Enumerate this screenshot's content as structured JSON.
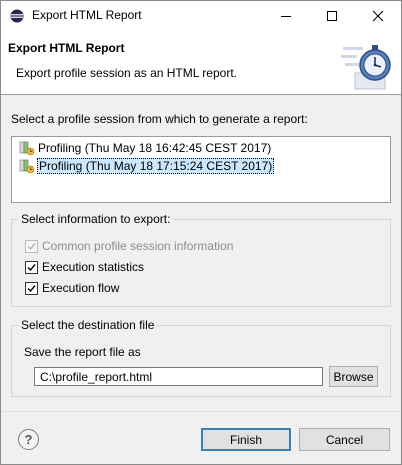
{
  "window": {
    "title": "Export HTML Report"
  },
  "header": {
    "title": "Export HTML Report",
    "description": "Export profile session as an HTML report."
  },
  "sessions": {
    "label": "Select a profile session from which to generate a report:",
    "items": [
      {
        "label": "Profiling  (Thu May 18 16:42:45 CEST 2017)",
        "selected": false
      },
      {
        "label": "Profiling  (Thu May 18 17:15:24 CEST 2017)",
        "selected": true
      }
    ]
  },
  "export_info": {
    "group_title": "Select information to export:",
    "options": [
      {
        "label": "Common profile session information",
        "checked": true,
        "enabled": false
      },
      {
        "label": "Execution statistics",
        "checked": true,
        "enabled": true
      },
      {
        "label": "Execution flow",
        "checked": true,
        "enabled": true
      }
    ]
  },
  "destination": {
    "group_title": "Select the destination file",
    "field_label": "Save the report file as",
    "file_value": "C:\\profile_report.html",
    "browse_label": "Browse"
  },
  "footer": {
    "help_symbol": "?",
    "finish_label": "Finish",
    "cancel_label": "Cancel"
  },
  "colors": {
    "selection_bg": "#cce8ff",
    "default_button_border": "#3c7fb1"
  }
}
